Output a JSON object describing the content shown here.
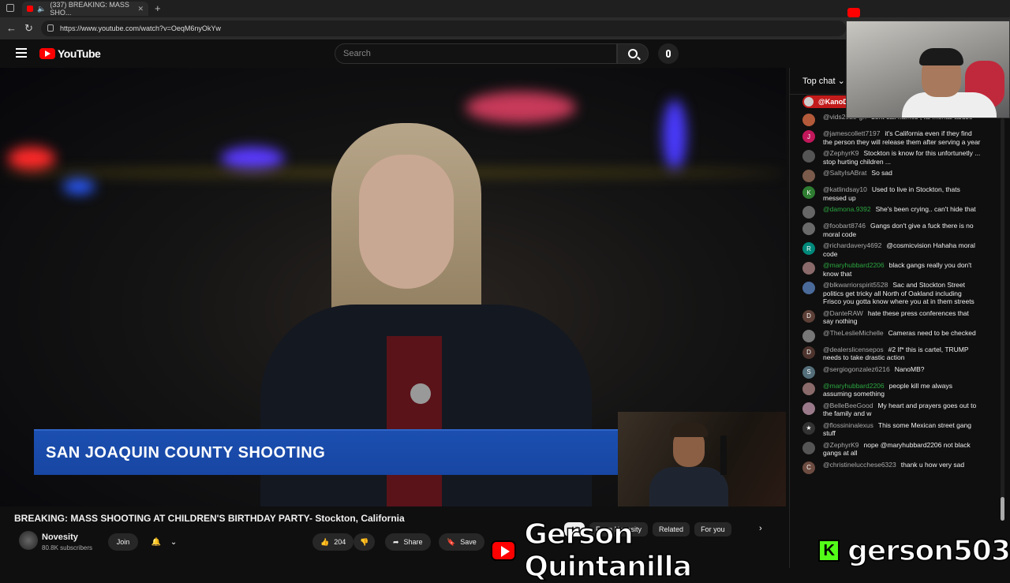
{
  "browser": {
    "tab_title": "(337) BREAKING: MASS SHO...",
    "url": "https://www.youtube.com/watch?v=OeqM6nyOkYw"
  },
  "youtube": {
    "logo_text": "YouTube",
    "search_placeholder": "Search"
  },
  "video": {
    "lower_third": "SAN JOAQUIN COUNTY SHOOTING",
    "title": "BREAKING: MASS SHOOTING AT CHILDREN'S BIRTHDAY PARTY- Stockton, California",
    "channel": "Novesity",
    "subscribers": "80.8K subscribers",
    "join_label": "Join",
    "likes": "204",
    "share_label": "Share",
    "save_label": "Save"
  },
  "filters": [
    "All",
    "From Novesity",
    "Related",
    "For you"
  ],
  "chat": {
    "header": "Top chat",
    "pinned_user": "@KanoD",
    "messages": [
      {
        "author": "@vids2025-gh",
        "text": "dont call names , its mental abuse",
        "avatar": "",
        "color": "#b35a3a",
        "member": false
      },
      {
        "author": "@jamescollett7197",
        "text": "it's California even if they find the person they will release them after serving a year",
        "avatar": "J",
        "color": "#c2185b",
        "member": false
      },
      {
        "author": "@ZephyrK9",
        "text": "Stockton is know for this unfortunetly ... stop hurting children ...",
        "avatar": "",
        "color": "#555",
        "member": false
      },
      {
        "author": "@SaltyIsABrat",
        "text": "So sad",
        "avatar": "",
        "color": "#7a5a4a",
        "member": false
      },
      {
        "author": "@katlindsay10",
        "text": "Used to live in Stockton, thats messed up",
        "avatar": "K",
        "color": "#2e7d32",
        "member": false
      },
      {
        "author": "@damona.9392",
        "text": "She's been crying.. can't hide that",
        "avatar": "",
        "color": "#666",
        "member": true
      },
      {
        "author": "@foobart8746",
        "text": "Gangs don't give a fuck there is no moral code",
        "avatar": "",
        "color": "#6a6a6a",
        "member": false
      },
      {
        "author": "@richardavery4692",
        "text": "@cosmicvision Hahaha moral code",
        "avatar": "R",
        "color": "#00897b",
        "member": false
      },
      {
        "author": "@maryhubbard2206",
        "text": "black gangs really you don't know that",
        "avatar": "",
        "color": "#8a6a6a",
        "member": true
      },
      {
        "author": "@blkwarriorspirit5528",
        "text": "Sac and Stockton Street politics get tricky all North of Oakland including Frisco you gotta know where you at in them streets",
        "avatar": "",
        "color": "#4a6a9a",
        "member": false
      },
      {
        "author": "@DanteRAW",
        "text": "hate these press conferences that say nothing",
        "avatar": "D",
        "color": "#5d4037",
        "member": false
      },
      {
        "author": "@TheLeslieMichelle",
        "text": "Cameras need to be checked",
        "avatar": "",
        "color": "#777",
        "member": false
      },
      {
        "author": "@dealerslicensepos",
        "text": "#2 If* this is cartel, TRUMP needs to take drastic action",
        "avatar": "D",
        "color": "#4e342e",
        "member": false
      },
      {
        "author": "@sergiogonzalez6216",
        "text": "NanoMB?",
        "avatar": "S",
        "color": "#546e7a",
        "member": false
      },
      {
        "author": "@maryhubbard2206",
        "text": "people kill me always assuming something",
        "avatar": "",
        "color": "#8a6a6a",
        "member": true
      },
      {
        "author": "@BelleBeeGood",
        "text": "My heart and prayers goes out to the family and w",
        "avatar": "",
        "color": "#9a7a8a",
        "member": false
      },
      {
        "author": "@flossininalexus",
        "text": "This some Mexican street gang stuff",
        "avatar": "★",
        "color": "#333",
        "member": false
      },
      {
        "author": "@ZephyrK9",
        "text": "nope @maryhubbard2206 not black gangs at all",
        "avatar": "",
        "color": "#555",
        "member": false
      },
      {
        "author": "@christinelucchese6323",
        "text": "thank u how very sad",
        "avatar": "C",
        "color": "#6d4c41",
        "member": false
      }
    ]
  },
  "stream_overlay": {
    "youtube_name": "Gerson Quintanilla",
    "kick_name": "gerson503"
  }
}
